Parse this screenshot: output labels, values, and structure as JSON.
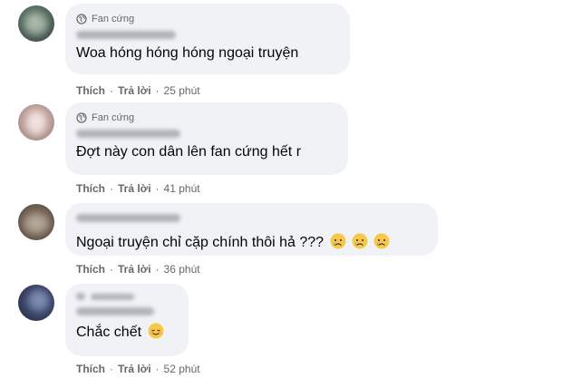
{
  "comments": [
    {
      "badge": "Fan cứng",
      "text": "Woa hóng hóng hóng ngoại truyện",
      "like": "Thích",
      "reply": "Trả lời",
      "time": "25 phút"
    },
    {
      "badge": "Fan cứng",
      "text": "Đợt này con dân lên fan cứng hết r",
      "like": "Thích",
      "reply": "Trả lời",
      "time": "41 phút"
    },
    {
      "text": "Ngoại truyện chỉ cặp chính thôi hả ???",
      "like": "Thích",
      "reply": "Trả lời",
      "time": "36 phút"
    },
    {
      "text": "Chắc chết",
      "like": "Thích",
      "reply": "Trả lời",
      "time": "52 phút"
    }
  ],
  "icons": {
    "badge": "globe-icon",
    "emoji_sad": "sad-emoji-icon",
    "emoji_relieved": "relieved-emoji-icon"
  },
  "colors": {
    "bubble": "#f0f2f5",
    "meta_text": "#65676b",
    "text": "#050505"
  }
}
